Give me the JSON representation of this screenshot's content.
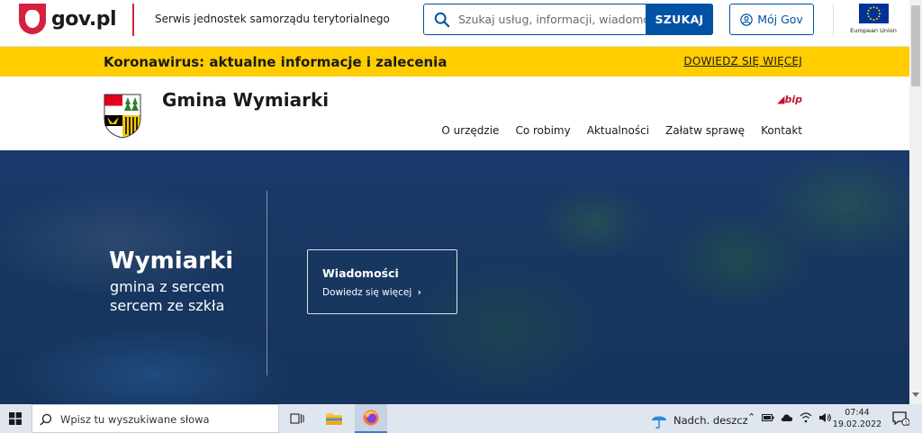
{
  "gov": {
    "logo": "gov.pl",
    "service": "Serwis jednostek samorządu terytorialnego"
  },
  "search": {
    "placeholder": "Szukaj usług, informacji, wiadomości",
    "button": "SZUKAJ"
  },
  "account": {
    "label": "Mój Gov"
  },
  "eu": {
    "label": "European Union"
  },
  "covid": {
    "title": "Koronawirus: aktualne informacje i zalecenia",
    "link": "DOWIEDZ SIĘ WIĘCEJ"
  },
  "muni": {
    "name": "Gmina Wymiarki",
    "bip": "bip"
  },
  "nav": [
    "O urzędzie",
    "Co robimy",
    "Aktualności",
    "Załatw sprawę",
    "Kontakt"
  ],
  "hero": {
    "title": "Wymiarki",
    "subtitle1": "gmina z sercem",
    "subtitle2": "sercem ze szkła",
    "card_title": "Wiadomości",
    "card_link": "Dowiedz się więcej"
  },
  "taskbar": {
    "search_placeholder": "Wpisz tu wyszukiwane słowa",
    "weather": "Nadch. deszcz",
    "time": "07:44",
    "date": "19.02.2022"
  },
  "colors": {
    "primary": "#0052a5",
    "covid": "#ffcd00",
    "accent_red": "#d4213d"
  }
}
